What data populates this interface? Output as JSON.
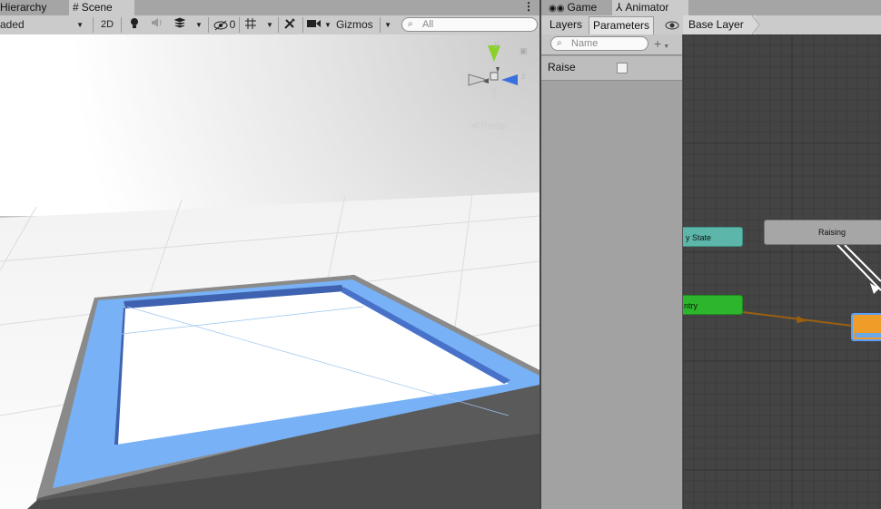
{
  "tabs_left": [
    {
      "label": "Hierarchy",
      "icon": "hierarchy-icon"
    },
    {
      "label": "Scene",
      "icon": "hash-icon"
    }
  ],
  "tabs_right": [
    {
      "label": "Game",
      "icon": "gamepad-icon"
    },
    {
      "label": "Animator",
      "icon": "animator-icon"
    }
  ],
  "scene_toolbar": {
    "shading_mode": "aded",
    "mode_2d": "2D",
    "hidden_count": "0",
    "gizmos_label": "Gizmos",
    "search_placeholder": "All"
  },
  "gizmo": {
    "y_label": "y",
    "z_label": "z",
    "projection": "Persp"
  },
  "animator": {
    "tab_layers": "Layers",
    "tab_parameters": "Parameters",
    "breadcrumb": "Base Layer",
    "search_placeholder": "Name",
    "parameters": [
      {
        "name": "Raise",
        "type": "trigger",
        "checked": false
      }
    ],
    "nodes": {
      "any_state": "y State",
      "entry": "ntry",
      "raising": "Raising"
    }
  },
  "colors": {
    "any_state": "#5cb7aa",
    "entry": "#2db62d",
    "state_default": "#f09c28",
    "state_node": "#a6a6a6",
    "transition": "#9a6010",
    "frame": "#78b1f5"
  }
}
